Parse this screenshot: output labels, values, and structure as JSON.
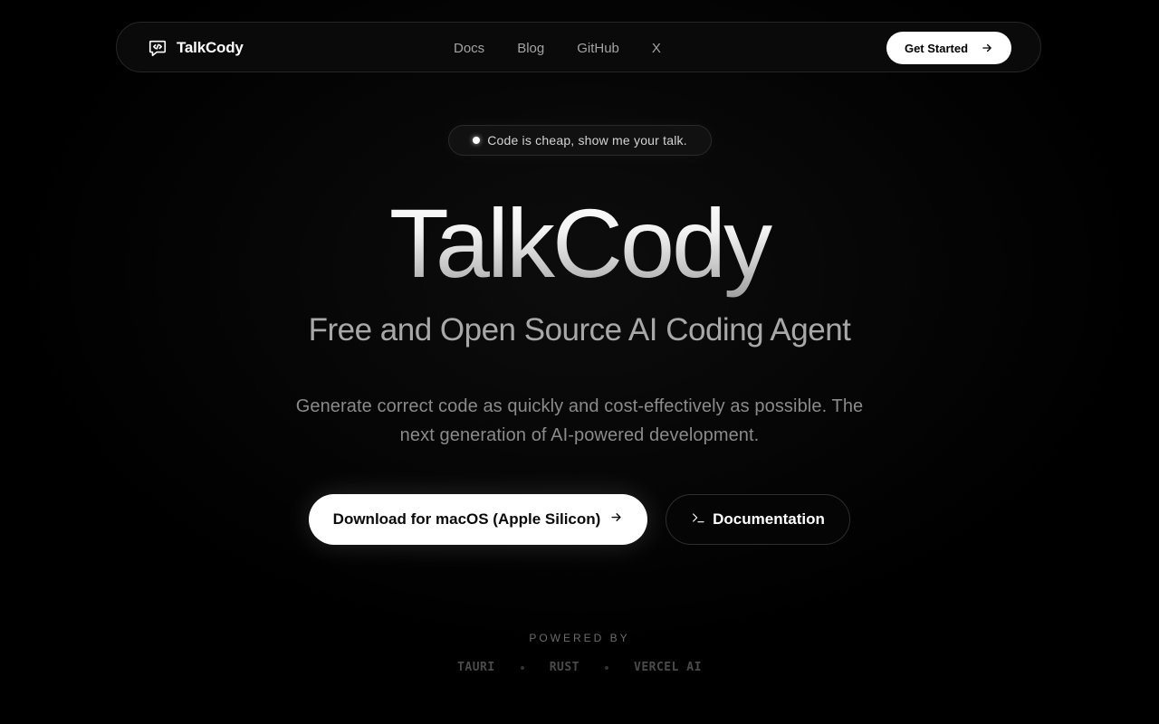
{
  "nav": {
    "brand_name": "TalkCody",
    "brand_icon": "code-chat-icon",
    "links": [
      {
        "label": "Docs"
      },
      {
        "label": "Blog"
      },
      {
        "label": "GitHub"
      },
      {
        "label": "X"
      }
    ],
    "cta_label": "Get Started",
    "cta_icon": "arrow-right-icon"
  },
  "hero": {
    "tagline": "Code is cheap, show me your talk.",
    "title": "TalkCody",
    "subtitle": "Free and Open Source AI Coding Agent",
    "description": "Generate correct code as quickly and cost-effectively as possible. The next generation of AI-powered development.",
    "primary_button": "Download for macOS (Apple Silicon)",
    "primary_icon": "arrow-right-icon",
    "secondary_button": "Documentation",
    "secondary_icon": "terminal-icon"
  },
  "powered_by": {
    "label": "POWERED BY",
    "items": [
      "TAURI",
      "RUST",
      "VERCEL AI"
    ]
  },
  "colors": {
    "background": "#000000",
    "accent": "#ffffff",
    "muted_text": "#8a8a8a"
  }
}
